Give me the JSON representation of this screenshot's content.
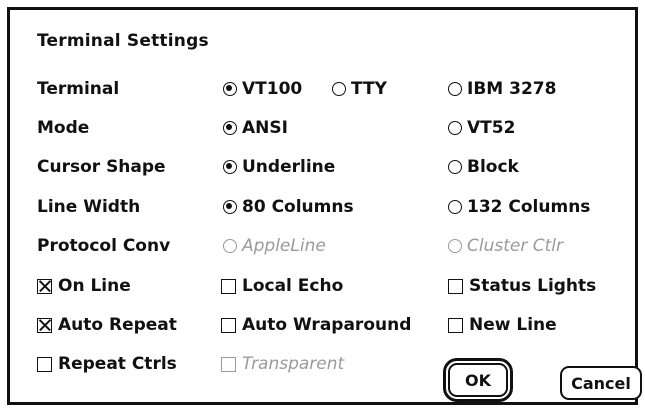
{
  "dialog": {
    "title": "Terminal Settings",
    "rows": [
      {
        "label": "Terminal",
        "options": [
          {
            "label": "VT100",
            "kind": "radio",
            "selected": true,
            "enabled": true
          },
          {
            "label": "TTY",
            "kind": "radio",
            "selected": false,
            "enabled": true
          },
          {
            "label": "IBM 3278",
            "kind": "radio",
            "selected": false,
            "enabled": true
          }
        ]
      },
      {
        "label": "Mode",
        "options": [
          {
            "label": "ANSI",
            "kind": "radio",
            "selected": true,
            "enabled": true
          },
          {
            "label": "VT52",
            "kind": "radio",
            "selected": false,
            "enabled": true
          }
        ]
      },
      {
        "label": "Cursor Shape",
        "options": [
          {
            "label": "Underline",
            "kind": "radio",
            "selected": true,
            "enabled": true
          },
          {
            "label": "Block",
            "kind": "radio",
            "selected": false,
            "enabled": true
          }
        ]
      },
      {
        "label": "Line Width",
        "options": [
          {
            "label": "80 Columns",
            "kind": "radio",
            "selected": true,
            "enabled": true
          },
          {
            "label": "132 Columns",
            "kind": "radio",
            "selected": false,
            "enabled": true
          }
        ]
      },
      {
        "label": "Protocol Conv",
        "options": [
          {
            "label": "AppleLine",
            "kind": "radio",
            "selected": false,
            "enabled": false
          },
          {
            "label": "Cluster Ctlr",
            "kind": "radio",
            "selected": false,
            "enabled": false
          }
        ]
      }
    ],
    "checkboxes": [
      {
        "label": "On Line",
        "checked": true,
        "enabled": true
      },
      {
        "label": "Local Echo",
        "checked": false,
        "enabled": true
      },
      {
        "label": "Status Lights",
        "checked": false,
        "enabled": true
      },
      {
        "label": "Auto Repeat",
        "checked": true,
        "enabled": true
      },
      {
        "label": "Auto Wraparound",
        "checked": false,
        "enabled": true
      },
      {
        "label": "New Line",
        "checked": false,
        "enabled": true
      },
      {
        "label": "Repeat Ctrls",
        "checked": false,
        "enabled": true
      },
      {
        "label": "Transparent",
        "checked": false,
        "enabled": false
      }
    ],
    "buttons": {
      "ok": "OK",
      "cancel": "Cancel"
    }
  }
}
